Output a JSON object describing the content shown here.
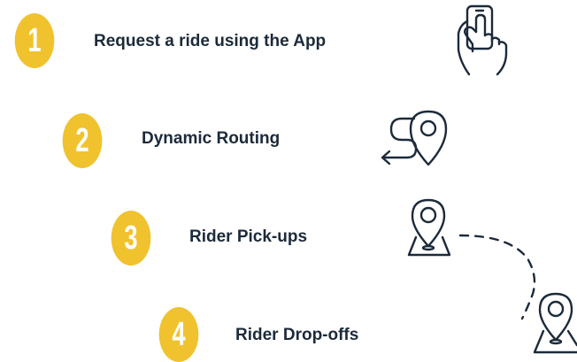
{
  "colors": {
    "accent": "#f0c22e",
    "text": "#1c2a3a",
    "background": "#ffffff"
  },
  "steps": [
    {
      "number": "1",
      "label": "Request a ride using the App",
      "icon": "hand-phone-icon"
    },
    {
      "number": "2",
      "label": "Dynamic Routing",
      "icon": "route-pin-icon"
    },
    {
      "number": "3",
      "label": "Rider Pick-ups",
      "icon": "map-pin-icon"
    },
    {
      "number": "4",
      "label": "Rider Drop-offs",
      "icon": "map-pin-icon"
    }
  ]
}
